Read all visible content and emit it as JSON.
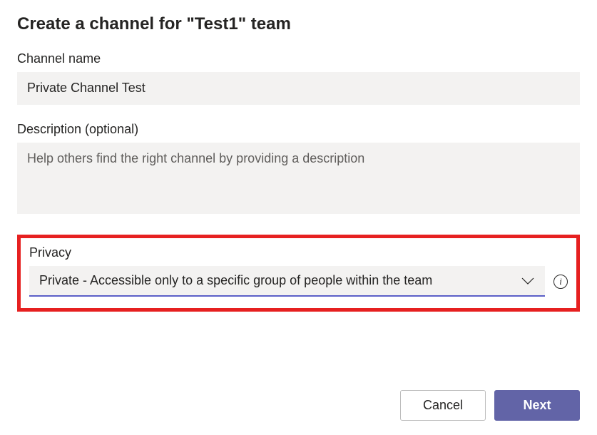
{
  "dialog": {
    "title": "Create a channel for \"Test1\" team"
  },
  "channelName": {
    "label": "Channel name",
    "value": "Private Channel Test"
  },
  "description": {
    "label": "Description (optional)",
    "placeholder": "Help others find the right channel by providing a description"
  },
  "privacy": {
    "label": "Privacy",
    "selected": "Private - Accessible only to a specific group of people within the team",
    "infoTooltip": "i"
  },
  "buttons": {
    "cancel": "Cancel",
    "next": "Next"
  }
}
